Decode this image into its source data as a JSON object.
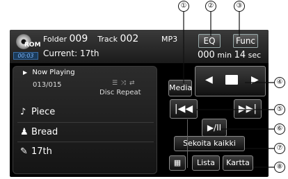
{
  "callouts": [
    "①",
    "②",
    "③",
    "④",
    "⑤",
    "⑥",
    "⑦",
    "⑧"
  ],
  "header": {
    "disc_label": "ROM",
    "time_code": "00:03",
    "folder_label": "Folder",
    "folder_number": "009",
    "track_label": "Track",
    "track_number": "002",
    "format": "MP3",
    "eq_label": "EQ",
    "func_label": "Func",
    "current_label": "Current:",
    "current_value": "17th",
    "elapsed_min": "000",
    "min_unit": "min",
    "elapsed_sec": "14",
    "sec_unit": "sec"
  },
  "now_playing": {
    "title": "Now Playing",
    "count": "013/015",
    "repeat_mode": "Disc Repeat",
    "piece": "Piece",
    "artist": "Bread",
    "album": "17th"
  },
  "controls": {
    "media_label": "Media",
    "shuffle_label": "Sekoita kaikki",
    "list_label": "Lista",
    "map_label": "Kartta"
  },
  "icons": [
    "disc-icon",
    "play-arrow-icon",
    "note-icon",
    "person-icon",
    "album-icon",
    "folder-prev-icon",
    "folder-icon",
    "folder-next-icon",
    "skip-back-icon",
    "play-pause-icon",
    "skip-forward-icon",
    "settings-icon"
  ]
}
